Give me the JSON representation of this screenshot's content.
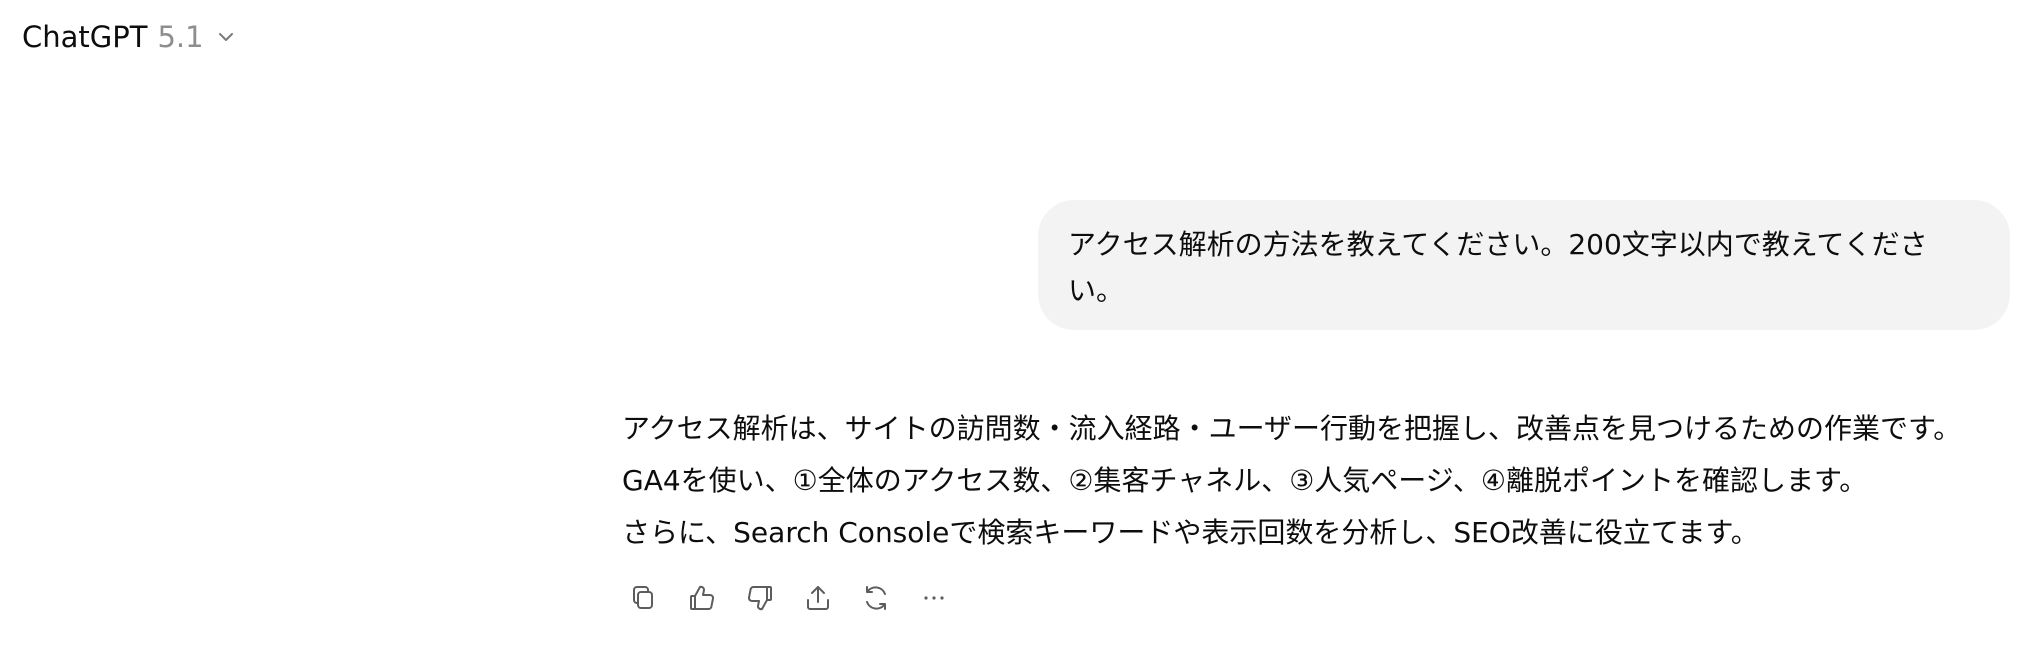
{
  "header": {
    "model_name": "ChatGPT",
    "model_version": "5.1",
    "chevron_icon": "chevron-down-icon"
  },
  "conversation": {
    "user_message": "アクセス解析の方法を教えてください。200文字以内で教えてください。",
    "assistant_lines": [
      "アクセス解析は、サイトの訪問数・流入経路・ユーザー行動を把握し、改善点を見つけるための作業です。",
      "GA4を使い、①全体のアクセス数、②集客チャネル、③人気ページ、④離脱ポイントを確認します。",
      "さらに、Search Consoleで検索キーワードや表示回数を分析し、SEO改善に役立てます。"
    ]
  },
  "actions": [
    {
      "icon": "copy-icon"
    },
    {
      "icon": "thumbs-up-icon"
    },
    {
      "icon": "thumbs-down-icon"
    },
    {
      "icon": "share-icon"
    },
    {
      "icon": "regenerate-icon"
    },
    {
      "icon": "more-icon"
    }
  ],
  "colors": {
    "text": "#0d0d0d",
    "muted": "#8e8e8e",
    "bubble": "#f3f3f3",
    "icon": "#5d5d5d"
  }
}
